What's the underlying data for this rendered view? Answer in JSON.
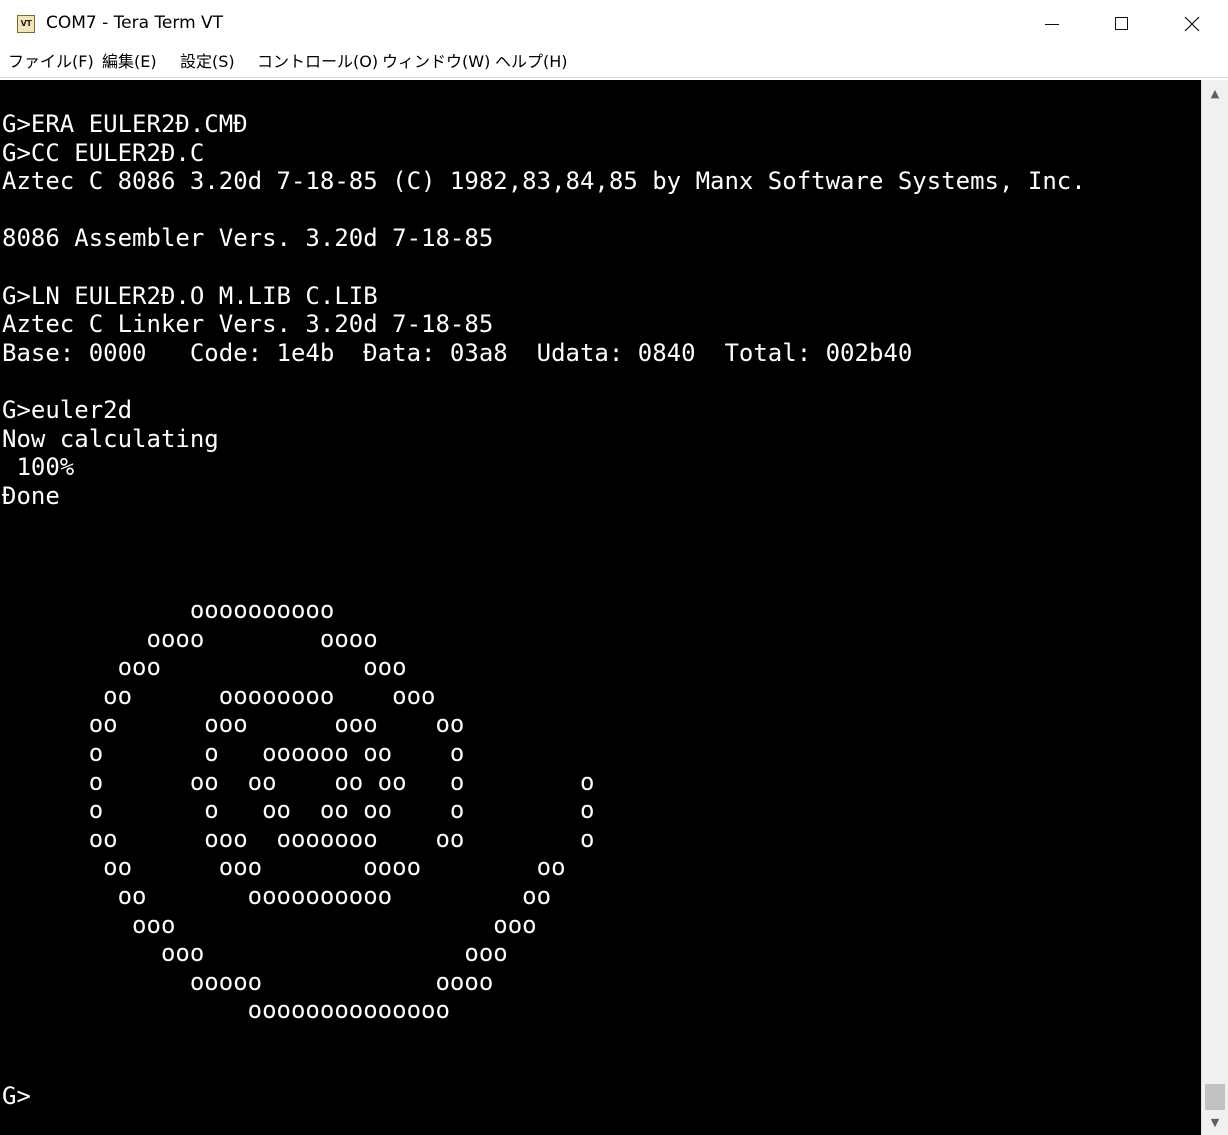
{
  "window": {
    "title": "COM7 - Tera Term VT",
    "app_icon_text": "VT"
  },
  "caption_buttons": {
    "minimize": "minimize",
    "maximize": "maximize",
    "close": "close"
  },
  "menu": {
    "items": [
      {
        "label": "ファイル(F)"
      },
      {
        "label": "編集(E)"
      },
      {
        "label": "設定(S)"
      },
      {
        "label": "コントロール(O)"
      },
      {
        "label": "ウィンドウ(W)"
      },
      {
        "label": "ヘルプ(H)"
      }
    ]
  },
  "terminal": {
    "background": "#000000",
    "foreground": "#ffffff",
    "lines": [
      "G>ERA EULER2Đ.CMĐ",
      "G>CC EULER2Đ.C",
      "Aztec C 8086 3.20d 7-18-85 (C) 1982,83,84,85 by Manx Software Systems, Inc.",
      "",
      "8086 Assembler Vers. 3.20d 7-18-85",
      "",
      "G>LN EULER2Đ.O M.LIB C.LIB",
      "Aztec C Linker Vers. 3.20d 7-18-85",
      "Base: 0000   Code: 1e4b  Đata: 03a8  Udata: 0840  Total: 002b40",
      "",
      "G>euler2d",
      "Now calculating",
      " 100%",
      "Đone",
      "",
      "",
      "",
      "             oooooooooo",
      "          oooo        oooo",
      "        ooo              ooo",
      "       oo      oooooooo    ooo",
      "      oo      ooo      ooo    oo",
      "      o       o   oooooo oo    o",
      "      o      oo  oo    oo oo   o        o",
      "      o       o   oo  oo oo    o        o",
      "      oo      ooo  ooooooo    oo        o",
      "       oo      ooo       oooo        oo",
      "        oo       oooooooooo         oo",
      "         ooo                      ooo",
      "           ooo                  ooo",
      "             ooooo            oooo",
      "                 oooooooooooooo",
      "",
      "",
      "G>"
    ]
  }
}
